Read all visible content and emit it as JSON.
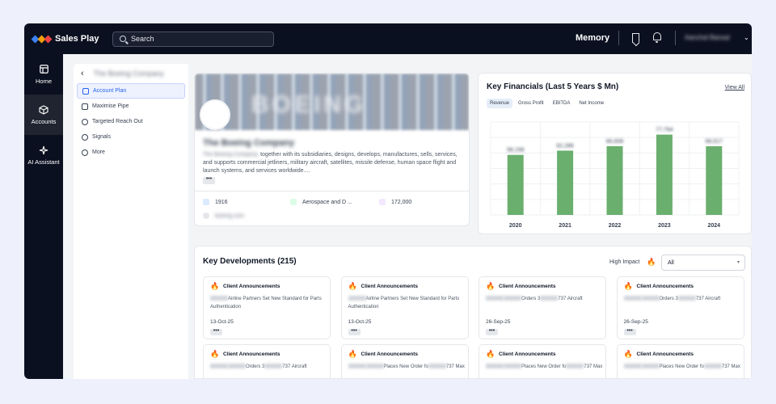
{
  "app": {
    "name": "Sales Play",
    "logo_colors": [
      "#3b82f6",
      "#f59e0b",
      "#ef4444"
    ]
  },
  "search": {
    "placeholder": "Search"
  },
  "header": {
    "memory_label": "Memory",
    "user_name": "Aanchal Bansal"
  },
  "leftnav": [
    {
      "label": "Home",
      "icon": "home-icon"
    },
    {
      "label": "Accounts",
      "icon": "cube-icon",
      "active": true
    },
    {
      "label": "AI Assistant",
      "icon": "sparkle-icon"
    }
  ],
  "subnav": {
    "account_name": "The Boeing Company",
    "items": [
      {
        "label": "Account Plan",
        "icon": "grid-icon",
        "active": true
      },
      {
        "label": "Maximise Pipe",
        "icon": "table-icon"
      },
      {
        "label": "Targeted Reach Out",
        "icon": "target-icon"
      },
      {
        "label": "Signals",
        "icon": "globe-icon"
      },
      {
        "label": "More",
        "icon": "compass-icon"
      }
    ]
  },
  "company": {
    "name": "The Boeing Company",
    "banner_text": "BOEING",
    "description_blurred": "The Boeing Company,",
    "description": " together with its subsidiaries, designs, develops, manufactures, sells, services, and supports commercial jetliners, military aircraft, satellites, missile defense, human space flight and launch systems, and services worldwide....",
    "founded": "1916",
    "industry": "Aerospace and D ...",
    "employees": "172,000",
    "website": "boeing.com",
    "more": "•••"
  },
  "financials": {
    "title": "Key Financials (Last 5 Years $ Mn)",
    "view_all": "View All",
    "tabs": [
      "Revenue",
      "Gross Profit",
      "EBITDA",
      "Net Income"
    ],
    "active_tab": "Revenue",
    "bar_color": "#6aaf6e"
  },
  "chart_data": {
    "type": "bar",
    "categories": [
      "2020",
      "2021",
      "2022",
      "2023",
      "2024"
    ],
    "values": [
      58158,
      62286,
      66608,
      77794,
      66517
    ],
    "title": "Key Financials (Last 5 Years $ Mn)",
    "xlabel": "",
    "ylabel": "",
    "ylim": [
      0,
      90000
    ],
    "grid": true
  },
  "developments": {
    "title": "Key Developments (215)",
    "high_impact_label": "High Impact",
    "filter_value": "All",
    "cards": [
      {
        "type": "Client Announcements",
        "text_tail": "Airline Partners Set New Standard for Parts Authentication",
        "date": "13-Oct-25"
      },
      {
        "type": "Client Announcements",
        "text_tail": "Airline Partners Set New Standard for Parts Authentication",
        "date": "13-Oct-25"
      },
      {
        "type": "Client Announcements",
        "text_tail": "Orders 3",
        "text_tail2": "737 Aircraft",
        "date": "26-Sep-25"
      },
      {
        "type": "Client Announcements",
        "text_tail": "Orders 3",
        "text_tail2": "737 Aircraft",
        "date": "26-Sep-25"
      },
      {
        "type": "Client Announcements",
        "text_tail": "Orders 3",
        "text_tail2": "737 Aircraft",
        "date": ""
      },
      {
        "type": "Client Announcements",
        "text_tail": "Places New Order fo",
        "text_tail2": "737 Max",
        "date": ""
      },
      {
        "type": "Client Announcements",
        "text_tail": "Places New Order fo",
        "text_tail2": "737 Max",
        "date": ""
      },
      {
        "type": "Client Announcements",
        "text_tail": "Places New Order fo",
        "text_tail2": "737 Max",
        "date": ""
      }
    ]
  }
}
